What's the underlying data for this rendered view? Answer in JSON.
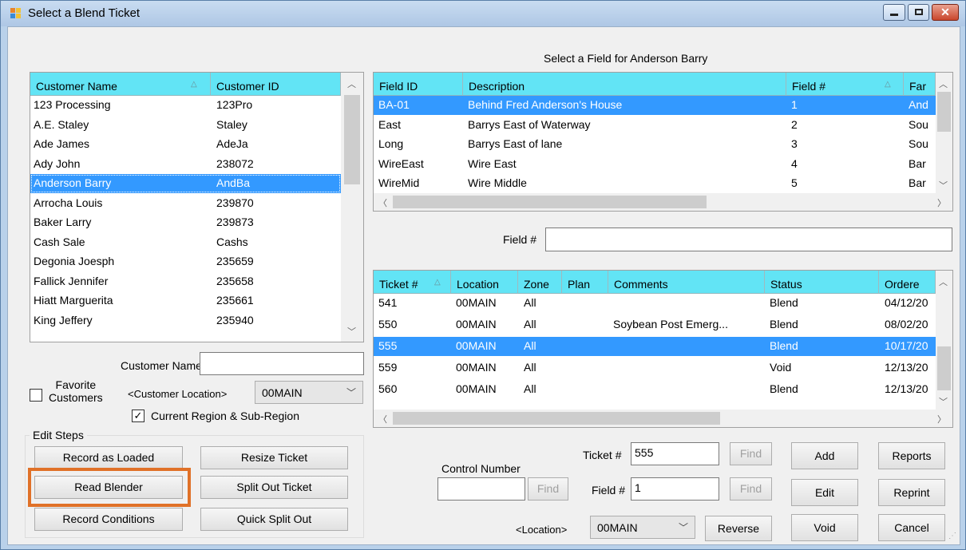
{
  "window": {
    "title": "Select a Blend Ticket"
  },
  "customers": {
    "col_name": "Customer Name",
    "col_id": "Customer ID",
    "rows": [
      {
        "name": "123 Processing",
        "id": "123Pro"
      },
      {
        "name": "A.E. Staley",
        "id": "Staley"
      },
      {
        "name": "Ade James",
        "id": "AdeJa"
      },
      {
        "name": "Ady John",
        "id": "238072"
      },
      {
        "name": "Anderson Barry",
        "id": "AndBa"
      },
      {
        "name": "Arrocha Louis",
        "id": "239870"
      },
      {
        "name": "Baker Larry",
        "id": "239873"
      },
      {
        "name": "Cash Sale",
        "id": "Cashs"
      },
      {
        "name": "Degonia Joesph",
        "id": "235659"
      },
      {
        "name": "Fallick Jennifer",
        "id": "235658"
      },
      {
        "name": "Hiatt Marguerita",
        "id": "235661"
      },
      {
        "name": "King Jeffery",
        "id": "235940"
      }
    ],
    "selected_index": 4
  },
  "fields": {
    "caption": "Select a Field for Anderson Barry",
    "col_id": "Field ID",
    "col_desc": "Description",
    "col_num": "Field #",
    "col_farm": "Far",
    "rows": [
      {
        "id": "BA-01",
        "desc": "Behind Fred Anderson's House",
        "num": "1",
        "farm": "And"
      },
      {
        "id": "East",
        "desc": "Barrys East of Waterway",
        "num": "2",
        "farm": "Sou"
      },
      {
        "id": "Long",
        "desc": "Barrys East of lane",
        "num": "3",
        "farm": "Sou"
      },
      {
        "id": "WireEast",
        "desc": "Wire East",
        "num": "4",
        "farm": "Bar"
      },
      {
        "id": "WireMid",
        "desc": "Wire Middle",
        "num": "5",
        "farm": "Bar"
      }
    ],
    "selected_index": 0
  },
  "field_filter": {
    "label": "Field #",
    "value": ""
  },
  "tickets": {
    "col_ticket": "Ticket #",
    "col_location": "Location",
    "col_zone": "Zone",
    "col_plan": "Plan",
    "col_comments": "Comments",
    "col_status": "Status",
    "col_ordered": "Ordere",
    "rows": [
      {
        "ticket": "541",
        "location": "00MAIN",
        "zone": "All",
        "plan": "",
        "comments": "",
        "status": "Blend",
        "ordered": "04/12/20"
      },
      {
        "ticket": "550",
        "location": "00MAIN",
        "zone": "All",
        "plan": "",
        "comments": "Soybean Post Emerg...",
        "status": "Blend",
        "ordered": "08/02/20"
      },
      {
        "ticket": "555",
        "location": "00MAIN",
        "zone": "All",
        "plan": "",
        "comments": "",
        "status": "Blend",
        "ordered": "10/17/20"
      },
      {
        "ticket": "559",
        "location": "00MAIN",
        "zone": "All",
        "plan": "",
        "comments": "",
        "status": "Void",
        "ordered": "12/13/20"
      },
      {
        "ticket": "560",
        "location": "00MAIN",
        "zone": "All",
        "plan": "",
        "comments": "",
        "status": "Blend",
        "ordered": "12/13/20"
      }
    ],
    "selected_index": 2
  },
  "filters": {
    "customer_name_label": "Customer Name",
    "customer_name_value": "",
    "favorite_label_1": "Favorite",
    "favorite_label_2": "Customers",
    "favorite_checked": false,
    "customer_location_label": "<Customer Location>",
    "customer_location_value": "00MAIN",
    "current_region_label": "Current Region & Sub-Region",
    "current_region_checked": true
  },
  "edit_steps": {
    "label": "Edit Steps",
    "record_as_loaded": "Record as Loaded",
    "resize_ticket": "Resize Ticket",
    "read_blender": "Read Blender",
    "split_out_ticket": "Split Out Ticket",
    "record_conditions": "Record Conditions",
    "quick_split_out": "Quick Split Out"
  },
  "lookup": {
    "control_number_label": "Control Number",
    "control_number_value": "",
    "ticket_label": "Ticket #",
    "ticket_value": "555",
    "field_label": "Field #",
    "field_value": "1",
    "find_label": "Find",
    "location_label": "<Location>",
    "location_value": "00MAIN"
  },
  "actions": {
    "add": "Add",
    "reports": "Reports",
    "edit": "Edit",
    "reprint": "Reprint",
    "reverse": "Reverse",
    "void": "Void",
    "cancel": "Cancel"
  },
  "colors": {
    "header": "#62e4f5",
    "selection": "#3399ff",
    "highlight": "#e07128"
  }
}
